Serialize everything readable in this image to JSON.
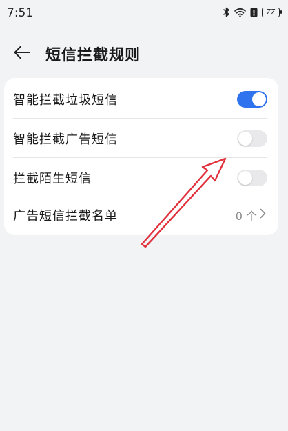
{
  "status_bar": {
    "time": "7:51",
    "battery_level": "77",
    "icons": [
      "bluetooth-icon",
      "wifi-icon",
      "alert-icon",
      "battery-icon"
    ]
  },
  "header": {
    "back_icon": "arrow-left-icon",
    "title": "短信拦截规则"
  },
  "settings": {
    "items": [
      {
        "label": "智能拦截垃圾短信",
        "type": "toggle",
        "enabled": true
      },
      {
        "label": "智能拦截广告短信",
        "type": "toggle",
        "enabled": false
      },
      {
        "label": "拦截陌生短信",
        "type": "toggle",
        "enabled": false
      },
      {
        "label": "广告短信拦截名单",
        "type": "link",
        "value": "0 个"
      }
    ]
  },
  "colors": {
    "accent": "#2f73ee",
    "background": "#f1f3f5",
    "card": "#ffffff",
    "annotation": "#e0313c"
  }
}
